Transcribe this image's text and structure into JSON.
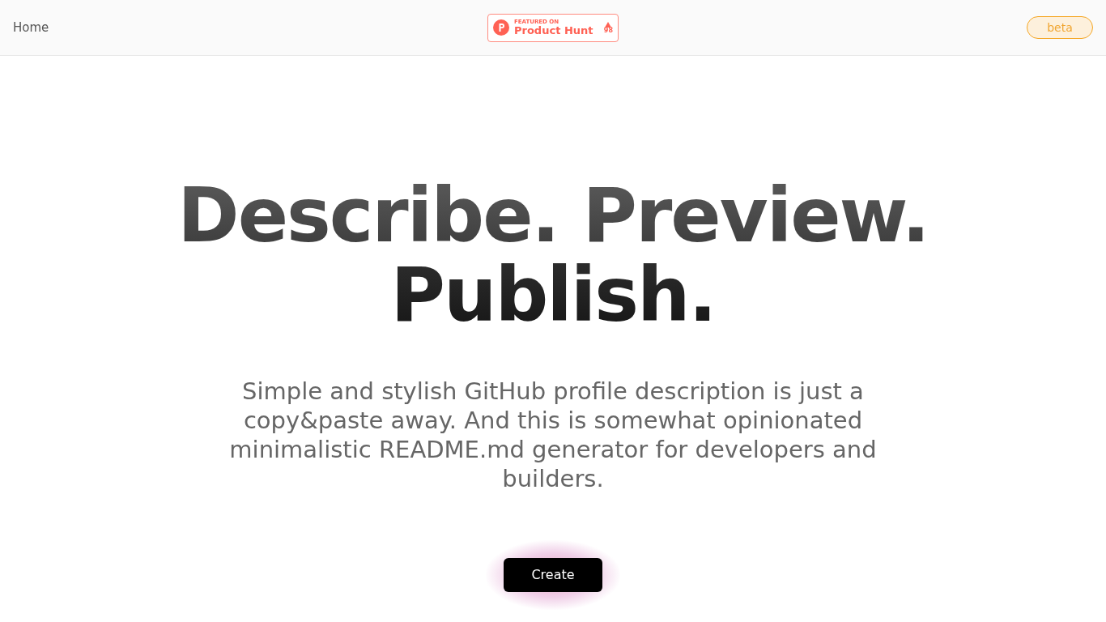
{
  "nav": {
    "home_link": "Home",
    "badge": {
      "caption": "FEATURED ON",
      "name": "Product Hunt",
      "votes": "98"
    },
    "beta_label": "beta"
  },
  "hero": {
    "headline_lines": [
      "Describe. Preview.",
      "Publish."
    ],
    "description": "Simple and stylish GitHub profile description is just a copy&paste away. And this is somewhat opinionated minimalistic README.md generator for developers and builders.",
    "button": "Create"
  }
}
